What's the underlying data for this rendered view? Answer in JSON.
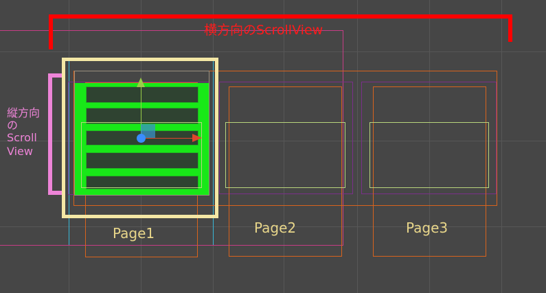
{
  "scene": {
    "horizontal_label": "横方向のScrollView",
    "vertical_label_lines": [
      "縦方向",
      "の",
      "Scroll",
      "View"
    ],
    "pages": [
      {
        "label": "Page1"
      },
      {
        "label": "Page2"
      },
      {
        "label": "Page3"
      }
    ],
    "colors": {
      "background": "#464646",
      "horizontal_bracket": "#ff0000",
      "vertical_bracket": "#ee84d8",
      "selection_frame": "#f4e7a5",
      "content_green": "#18e818",
      "outline_orange": "#d9631d",
      "outline_purple": "#7b2f8a",
      "guide_magenta": "#c63d86",
      "guide_cyan": "#38b8d8"
    }
  }
}
